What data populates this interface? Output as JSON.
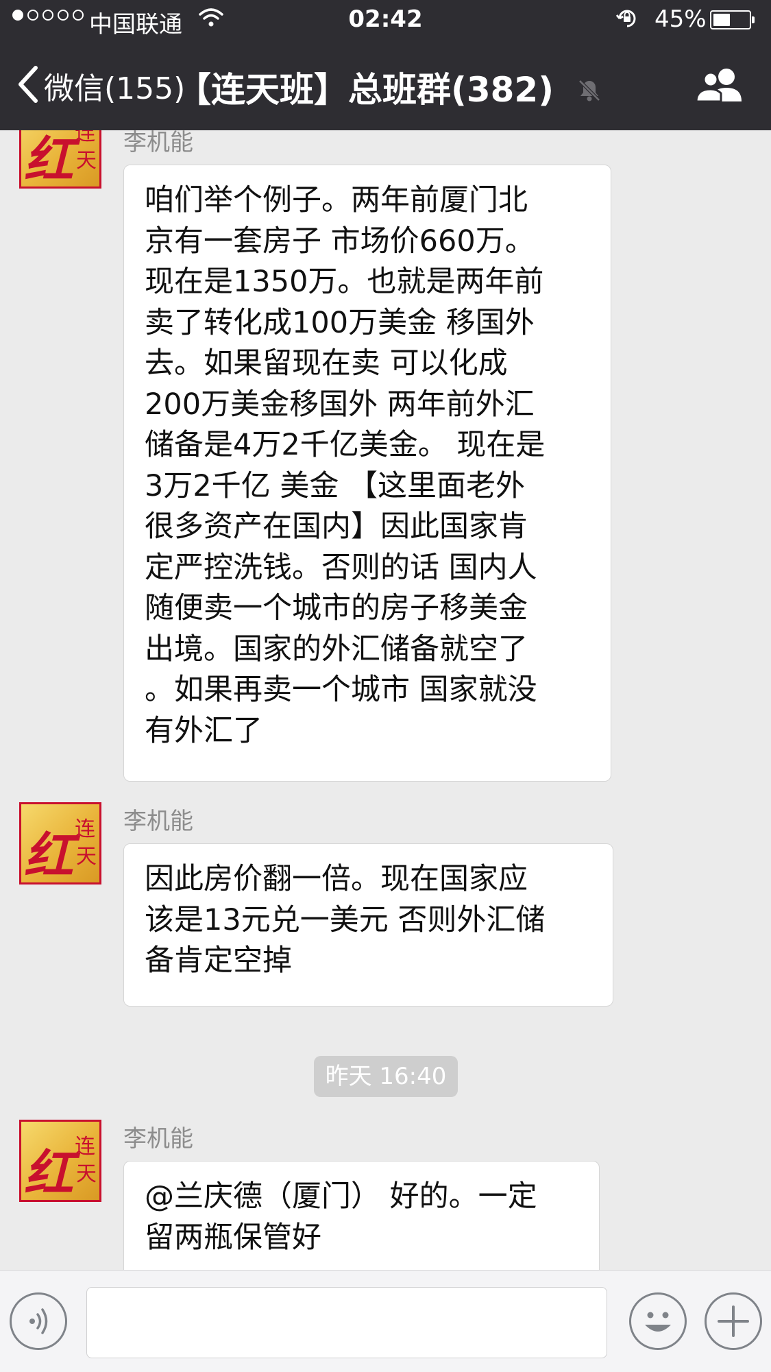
{
  "status_bar": {
    "carrier": "中国联通",
    "time": "02:42",
    "battery": "45%",
    "battery_level": 0.45,
    "signal_strength": "1 of 5"
  },
  "nav": {
    "back_label": "微信(155)",
    "title": "【连天班】总班群(382)",
    "title_icons": [
      "mute-icon"
    ],
    "right_icon": "members-icon"
  },
  "messages": [
    {
      "sender": "李机能",
      "avatar_glyphs": "红 连天",
      "text": "咱们举个例子。两年前厦门北\n京有一套房子 市场价660万。\n现在是1350万。也就是两年前\n卖了转化成100万美金 移国外\n去。如果留现在卖 可以化成\n200万美金移国外  两年前外汇\n储备是4万2千亿美金。 现在是\n3万2千亿 美金   【这里面老外\n很多资产在国内】因此国家肯\n定严控洗钱。否则的话  国内人\n随便卖一个城市的房子移美金\n出境。国家的外汇储备就空了\n。如果再卖一个城市  国家就没\n有外汇了"
    },
    {
      "sender": "李机能",
      "avatar_glyphs": "红 连天",
      "text": "因此房价翻一倍。现在国家应\n该是13元兑一美元  否则外汇储\n备肯定空掉"
    },
    {
      "timestamp": "昨天 16:40"
    },
    {
      "sender": "李机能",
      "avatar_glyphs": "红 连天",
      "text": "@兰庆德（厦门） 好的。一定\n留两瓶保管好"
    }
  ],
  "toolbar": {
    "input_value": "",
    "icons": [
      "voice-icon",
      "emoji-icon",
      "plus-icon"
    ]
  },
  "colors": {
    "header_bg": "#2e2d32",
    "chat_bg": "#ebebeb",
    "bubble_bg": "#ffffff",
    "avatar_red": "#c8102e",
    "avatar_gold": "#e9b43a",
    "timestamp_bg": "#cecece"
  }
}
